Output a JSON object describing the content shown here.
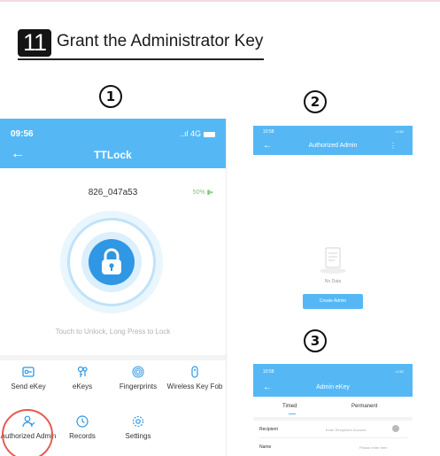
{
  "heading": {
    "step_number": "11",
    "title": "Grant the Administrator Key"
  },
  "steps": {
    "one": "①",
    "two": "②",
    "three": "③"
  },
  "phone1": {
    "time": "09:56",
    "signal": "..ıl 4G",
    "back_icon": "arrow-left-icon",
    "title": "TTLock",
    "lock_name": "826_047a53",
    "battery": "50%",
    "hint": "Touch to Unlock, Long Press to Lock",
    "menu": [
      {
        "label": "Send eKey",
        "icon": "send-ekey-icon"
      },
      {
        "label": "eKeys",
        "icon": "ekeys-icon"
      },
      {
        "label": "Fingerprints",
        "icon": "fingerprint-icon"
      },
      {
        "label": "Wireless Key Fob",
        "icon": "key-fob-icon"
      },
      {
        "label": "Authorized Admin",
        "icon": "admin-icon"
      },
      {
        "label": "Records",
        "icon": "records-icon"
      },
      {
        "label": "Settings",
        "icon": "settings-icon"
      }
    ],
    "accent": "#55b8f5",
    "highlight": "#e55a4e"
  },
  "phone2": {
    "time": "10:58",
    "signal": "..ıl 4G",
    "title": "Authorized Admin",
    "menu_icon": "more-vertical-icon",
    "empty_text": "No Data",
    "button": "Create Admin"
  },
  "phone3": {
    "time": "10:58",
    "signal": "..ıl 4G",
    "title": "Admin eKey",
    "tabs": [
      "Timed",
      "Permanent"
    ],
    "fields": [
      {
        "label": "Recipient",
        "placeholder": "Enter Recipient's Account"
      },
      {
        "label": "Name",
        "placeholder": "Please enter here"
      }
    ]
  }
}
